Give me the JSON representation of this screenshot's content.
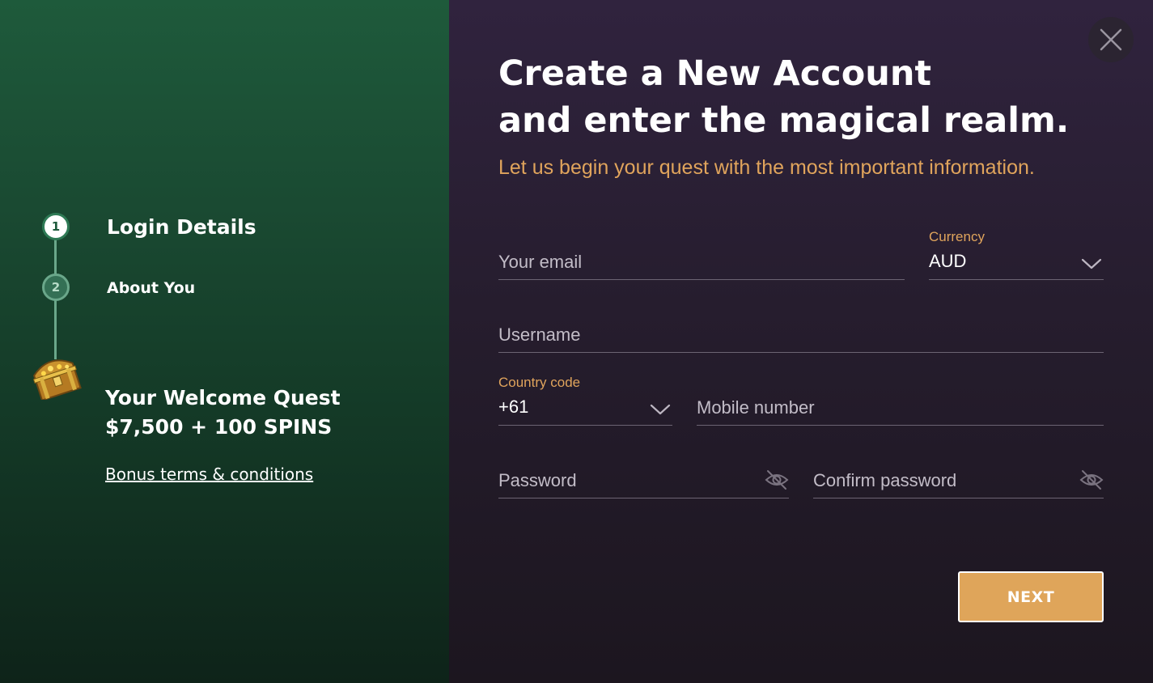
{
  "steps": [
    {
      "number": "1",
      "label": "Login Details",
      "state": "active"
    },
    {
      "number": "2",
      "label": "About You",
      "state": "upcoming"
    }
  ],
  "promo": {
    "title_line1": "Your Welcome Quest",
    "title_line2": "$7,500 + 100 SPINS",
    "terms_link": "Bonus terms & conditions",
    "icon": "treasure-chest-icon"
  },
  "close_icon": "close-icon",
  "heading": {
    "line1": "Create a New Account",
    "line2": "and enter the magical realm."
  },
  "subheading": "Let us begin your quest with the most important information.",
  "form": {
    "email": {
      "placeholder": "Your email",
      "value": ""
    },
    "currency": {
      "label": "Currency",
      "value": "AUD"
    },
    "username": {
      "placeholder": "Username",
      "value": ""
    },
    "country_code": {
      "label": "Country code",
      "value": "+61"
    },
    "mobile": {
      "placeholder": "Mobile number",
      "value": ""
    },
    "password": {
      "placeholder": "Password",
      "value": ""
    },
    "confirm_password": {
      "placeholder": "Confirm password",
      "value": ""
    }
  },
  "next_button": "NEXT",
  "colors": {
    "accent": "#dfa55a",
    "left_panel": "#1a4a32",
    "right_panel": "#261d2e",
    "label": "#e0a45c"
  }
}
